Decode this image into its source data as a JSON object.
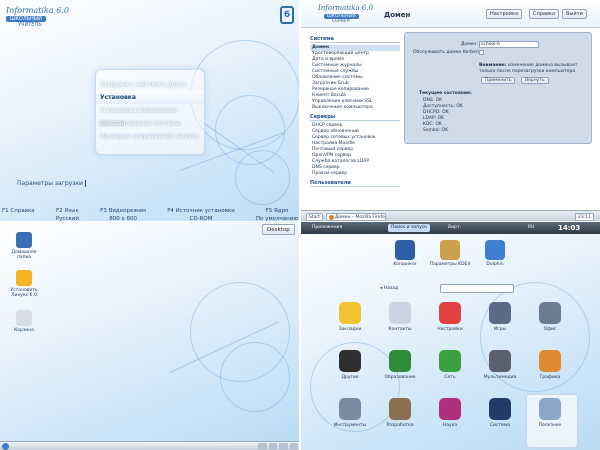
{
  "boot": {
    "logo": {
      "line1": "Informatika 6.0",
      "line2": "ШКОЛЬНЫЙ",
      "line3": "УЧИТЕЛЬ"
    },
    "corner_glyph": "6",
    "menu_items": [
      {
        "label": "Загрузка с жёсткого диска",
        "selected": false
      },
      {
        "label": "Установка",
        "selected": true
      },
      {
        "label": "Установка в безопасном режиме",
        "selected": false
      },
      {
        "label": "Восстановление системы",
        "selected": false
      },
      {
        "label": "Проверка оперативной памяти",
        "selected": false
      }
    ],
    "params_label": "Параметры загрузки",
    "fkeys": [
      {
        "line1": "F1 Справка",
        "line2": ""
      },
      {
        "line1": "F2 Язык",
        "line2": "Русский"
      },
      {
        "line1": "F3 Видеорежим",
        "line2": "800 x 600"
      },
      {
        "line1": "F4 Источник установки",
        "line2": "CD-ROM"
      },
      {
        "line1": "F5 Ядро",
        "line2": "По умолчанию"
      }
    ]
  },
  "desktop": {
    "desktop_button": "Desktop",
    "icons": [
      {
        "label": "Домашняя папка",
        "color": "#3a6fb5"
      },
      {
        "label": "Установить Линукс 6.0",
        "color": "#f0b323"
      },
      {
        "label": "Корзина",
        "color": "#d8dde4"
      }
    ]
  },
  "web": {
    "logo": {
      "line1": "Informatika 6.0",
      "line2": "ШКОЛЬНЫЙ",
      "line3": "СЕРВЕР"
    },
    "page_title": "Домен",
    "buttons": [
      "Настройка",
      "Справка",
      "Выйти"
    ],
    "sidebar": {
      "sections": [
        {
          "title": "Система",
          "items": [
            {
              "label": "Домен",
              "selected": true
            },
            {
              "label": "Удостоверяющий центр",
              "selected": false
            },
            {
              "label": "Дата и время",
              "selected": false
            },
            {
              "label": "Системные журналы",
              "selected": false
            },
            {
              "label": "Системные службы",
              "selected": false
            },
            {
              "label": "Обновление системы",
              "selected": false
            },
            {
              "label": "Загрузчик Grub",
              "selected": false
            },
            {
              "label": "Резервное копирование",
              "selected": false
            },
            {
              "label": "Клиент Bacula",
              "selected": false
            },
            {
              "label": "Управление ключами SSL",
              "selected": false
            },
            {
              "label": "Выключение компьютера",
              "selected": false
            }
          ]
        },
        {
          "title": "Серверы",
          "items": [
            {
              "label": "DHCP сервер",
              "selected": false
            },
            {
              "label": "Сервер обновлений",
              "selected": false
            },
            {
              "label": "Сервер сетевых установок",
              "selected": false
            },
            {
              "label": "Настройка Moodle",
              "selected": false
            },
            {
              "label": "Почтовый сервер",
              "selected": false
            },
            {
              "label": "OpenVPN сервер",
              "selected": false
            },
            {
              "label": "Служба каталогов LDAP",
              "selected": false
            },
            {
              "label": "DNS сервер",
              "selected": false
            },
            {
              "label": "Прокси-сервер",
              "selected": false
            }
          ]
        },
        {
          "title": "Пользователи",
          "items": []
        }
      ]
    },
    "form": {
      "domain_label": "Домен:",
      "domain_value": "school-6",
      "kerberos_label": "Обслуживать домен Kerberos:",
      "note_bold": "Внимание:",
      "note_text1": "изменение домена вызывает",
      "note_text2": "только после перезагрузки компьютера",
      "apply": "Применить",
      "revert": "Вернуть",
      "status_title": "Текущее состояние:",
      "status": [
        "DNS: OK",
        "Доступность: OK",
        "DHCPD: OK",
        "LDAP: OK",
        "KDC: OK",
        "Samba: OK"
      ]
    },
    "taskbar": {
      "start": "Start",
      "task": "Домен – Mozilla Firefox",
      "clock": "23:11"
    }
  },
  "kde": {
    "panel": {
      "apps": "Приложения",
      "search": "Поиск и запуск",
      "window": "Вирт.",
      "lang": "RU",
      "clock": "14:03"
    },
    "top_icons": [
      {
        "label": "Konqueror",
        "color": "#2d5fa8"
      },
      {
        "label": "Параметры KDE4",
        "color": "#c9a24a"
      },
      {
        "label": "Dolphin",
        "color": "#3f7fd0"
      }
    ],
    "back_label": "Назад",
    "grid": [
      {
        "label": "Закладки",
        "color": "#f2c230"
      },
      {
        "label": "Контакты",
        "color": "#c8d4e4"
      },
      {
        "label": "Настройки",
        "color": "#e04040"
      },
      {
        "label": "Игры",
        "color": "#5a6a88"
      },
      {
        "label": "Офис",
        "color": "#6c7c90"
      },
      {
        "label": "Другие",
        "color": "#2f2f2f"
      },
      {
        "label": "Образование",
        "color": "#2f8a3a"
      },
      {
        "label": "Сеть",
        "color": "#3aa040"
      },
      {
        "label": "Мультимедиа",
        "color": "#5a6070"
      },
      {
        "label": "Графика",
        "color": "#e08a30"
      },
      {
        "label": "Инструменты",
        "color": "#7a8aa0"
      },
      {
        "label": "Разработка",
        "color": "#8a7050"
      },
      {
        "label": "Наука",
        "color": "#b03080"
      },
      {
        "label": "Система",
        "color": "#243b6a"
      },
      {
        "label": "Полезное",
        "color": "#8aa6c8"
      }
    ]
  }
}
